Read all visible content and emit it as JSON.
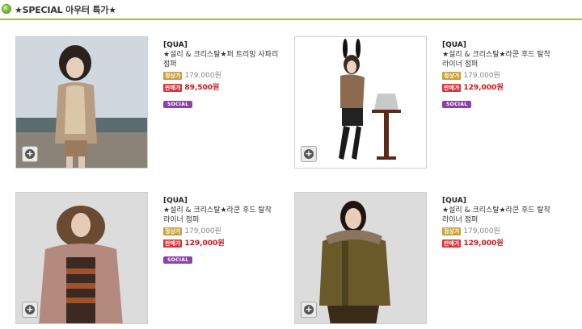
{
  "section": {
    "title": "★SPECIAL 아우터 특가★"
  },
  "products": [
    {
      "brand": "[QUA]",
      "name": "★설리 & 크리스탈★퍼 트리밍 사파리 점퍼",
      "regular_label": "정상가",
      "regular_price": "179,000원",
      "sale_label": "판매가",
      "sale_price": "89,500원",
      "badge": "SOCIAL"
    },
    {
      "brand": "[QUA]",
      "name": "★설리 & 크리스탈★라쿤 후드 탈착 라이너 점퍼",
      "regular_label": "정상가",
      "regular_price": "179,000원",
      "sale_label": "판매가",
      "sale_price": "129,000원",
      "badge": "SOCIAL"
    },
    {
      "brand": "[QUA]",
      "name": "★설리 & 크리스탈★라쿤 후드 탈착 라이너 점퍼",
      "regular_label": "정상가",
      "regular_price": "179,000원",
      "sale_label": "판매가",
      "sale_price": "129,000원",
      "badge": "SOCIAL"
    },
    {
      "brand": "[QUA]",
      "name": "★설리 & 크리스탈★라쿤 후드 탈착 라이너 점퍼",
      "regular_label": "정상가",
      "regular_price": "179,000원",
      "sale_label": "판매가",
      "sale_price": "129,000원"
    }
  ],
  "colors": {
    "accent": "#8cc63f",
    "sale_red": "#d0121b",
    "social_purple": "#8d3fb0"
  },
  "icons": {
    "header_bullet": "green-circle-bullet-icon",
    "zoom": "zoom-plus-icon"
  }
}
